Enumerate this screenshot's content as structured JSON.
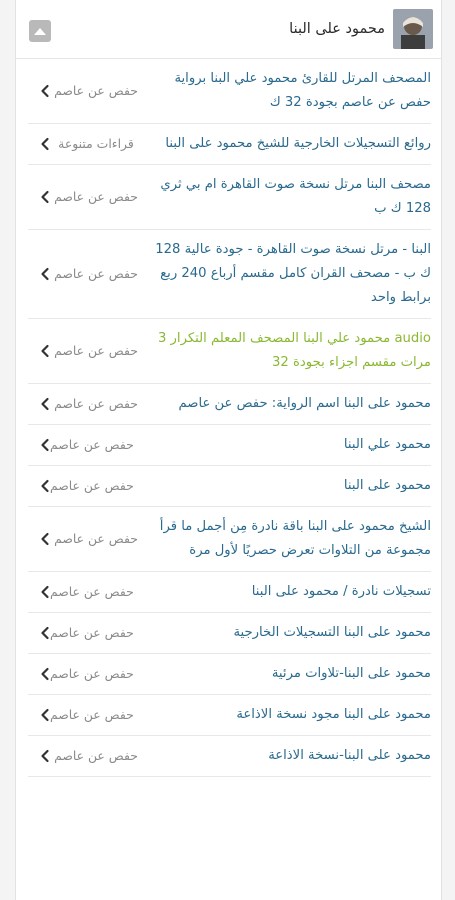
{
  "header": {
    "title": "محمود على البنا"
  },
  "items": [
    {
      "title": "المصحف المرتل للقارئ محمود علي البنا برواية حفص عن عاصم بجودة 32 ك",
      "meta": "حفص عن عاصم",
      "audio": false,
      "meta_single": false
    },
    {
      "title": "روائع التسجيلات الخارجية للشيخ محمود على البنا",
      "meta": "قراءات متنوعة",
      "audio": false,
      "meta_single": false
    },
    {
      "title": "مصحف البنا مرتل نسخة صوت القاهرة ام بي ثري 128 ك ب",
      "meta": "حفص عن عاصم",
      "audio": false,
      "meta_single": false
    },
    {
      "title": "البنا - مرتل نسخة صوت القاهرة - جودة عالية 128 ك ب - مصحف القران كامل مقسم أرباع 240 ربع برابط واحد",
      "meta": "حفص عن عاصم",
      "audio": false,
      "meta_single": false
    },
    {
      "title": "audio محمود علي البنا المصحف المعلم التكرار 3 مرات مقسم اجزاء بجودة 32",
      "meta": "حفص عن عاصم",
      "audio": true,
      "meta_single": false
    },
    {
      "title": "محمود على البنا اسم الرواية: حفص عن عاصم",
      "meta": "حفص عن عاصم",
      "audio": false,
      "meta_single": false
    },
    {
      "title": "محمود علي البنا",
      "meta": "حفص عن عاصم",
      "audio": false,
      "meta_single": true
    },
    {
      "title": "محمود على البنا",
      "meta": "حفص عن عاصم",
      "audio": false,
      "meta_single": true
    },
    {
      "title": "الشيخ محمود على البنا باقة نادرة مِن أجمل ما قرأ مجموعة من التلاوات تعرض حصريًا لأول مرة",
      "meta": "حفص عن عاصم",
      "audio": false,
      "meta_single": false
    },
    {
      "title": "تسجيلات نادرة / محمود على البنا",
      "meta": "حفص عن عاصم",
      "audio": false,
      "meta_single": true
    },
    {
      "title": "محمود على البنا التسجيلات الخارجية",
      "meta": "حفص عن عاصم",
      "audio": false,
      "meta_single": true
    },
    {
      "title": "محمود على البنا-تلاوات مرئية",
      "meta": "حفص عن عاصم",
      "audio": false,
      "meta_single": true
    },
    {
      "title": "محمود على البنا مجود نسخة الاذاعة",
      "meta": "حفص عن عاصم",
      "audio": false,
      "meta_single": true
    },
    {
      "title": "محمود على البنا-نسخة الاذاعة",
      "meta": "حفص عن عاصم",
      "audio": false,
      "meta_single": false
    }
  ],
  "colors": {
    "link": "#2a6a8e",
    "audio_link": "#8bb833",
    "meta": "#8a8a8a"
  }
}
